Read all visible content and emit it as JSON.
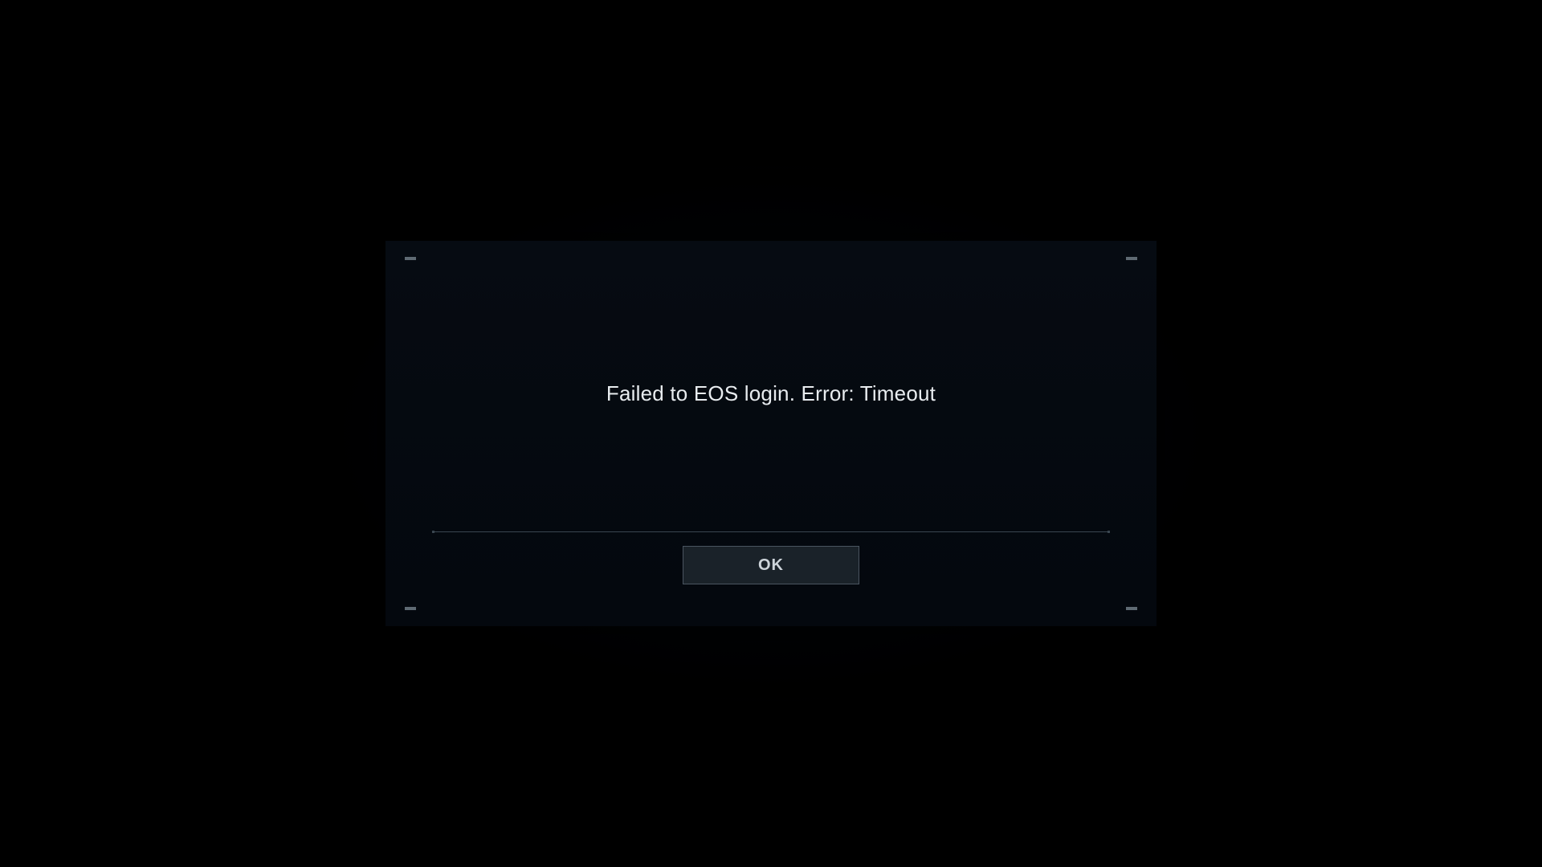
{
  "dialog": {
    "message": "Failed to EOS login. Error: Timeout",
    "ok_label": "OK"
  }
}
